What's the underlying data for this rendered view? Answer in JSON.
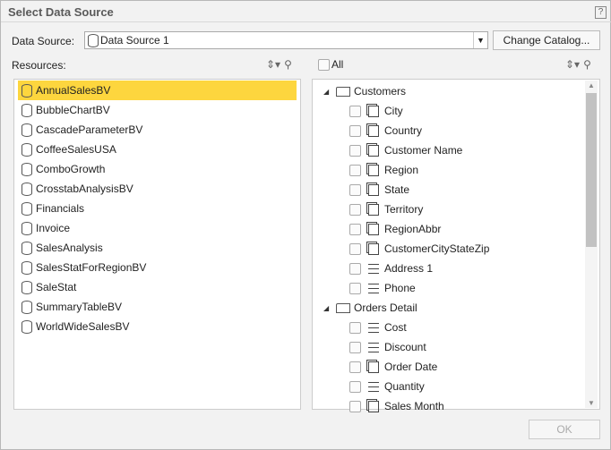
{
  "title": "Select Data Source",
  "help": "?",
  "data_source": {
    "label": "Data Source:",
    "value": "Data Source 1",
    "change_catalog": "Change Catalog..."
  },
  "resources": {
    "label": "Resources:",
    "selected": "AnnualSalesBV",
    "items": [
      "AnnualSalesBV",
      "BubbleChartBV",
      "CascadeParameterBV",
      "CoffeeSalesUSA",
      "ComboGrowth",
      "CrosstabAnalysisBV",
      "Financials",
      "Invoice",
      "SalesAnalysis",
      "SalesStatForRegionBV",
      "SaleStat",
      "SummaryTableBV",
      "WorldWideSalesBV"
    ]
  },
  "fields": {
    "all_label": "All",
    "tree": [
      {
        "type": "folder",
        "label": "Customers",
        "expanded": true
      },
      {
        "type": "dimension",
        "label": "City"
      },
      {
        "type": "dimension",
        "label": "Country"
      },
      {
        "type": "dimension",
        "label": "Customer Name"
      },
      {
        "type": "dimension",
        "label": "Region"
      },
      {
        "type": "dimension",
        "label": "State"
      },
      {
        "type": "dimension",
        "label": "Territory"
      },
      {
        "type": "dimension",
        "label": "RegionAbbr"
      },
      {
        "type": "dimension",
        "label": "CustomerCityStateZip"
      },
      {
        "type": "measure",
        "label": "Address 1"
      },
      {
        "type": "measure",
        "label": "Phone"
      },
      {
        "type": "folder",
        "label": "Orders Detail",
        "expanded": true
      },
      {
        "type": "measure",
        "label": "Cost"
      },
      {
        "type": "measure",
        "label": "Discount"
      },
      {
        "type": "dimension",
        "label": "Order Date"
      },
      {
        "type": "measure",
        "label": "Quantity"
      },
      {
        "type": "dimension",
        "label": "Sales Month"
      }
    ]
  },
  "ok": "OK",
  "colors": {
    "selection": "#fdd63e"
  }
}
